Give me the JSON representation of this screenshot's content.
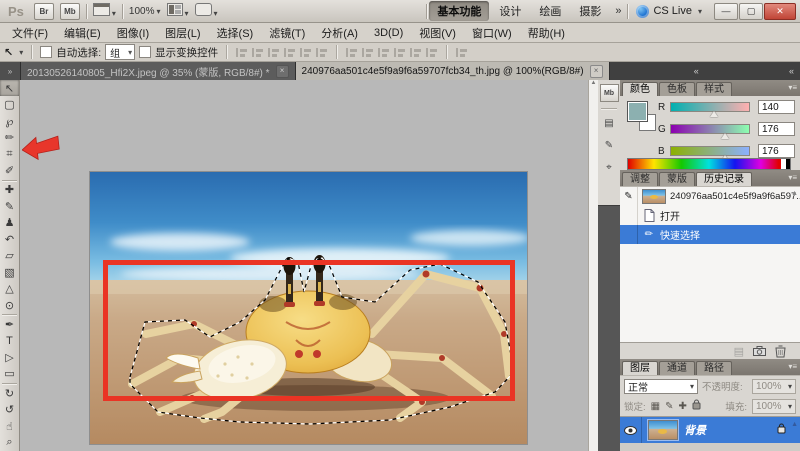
{
  "titlebar": {
    "logo": "Ps",
    "bridge_button": "Br",
    "minibridge_button": "Mb",
    "zoom_value": "100%",
    "workspaces": [
      "基本功能",
      "设计",
      "绘画",
      "摄影"
    ],
    "workspace_overflow": "»",
    "cs_live_label": "CS Live",
    "minimize_glyph": "—",
    "maximize_glyph": "▢",
    "close_glyph": "✕"
  },
  "menubar": [
    "文件(F)",
    "编辑(E)",
    "图像(I)",
    "图层(L)",
    "选择(S)",
    "滤镜(T)",
    "分析(A)",
    "3D(D)",
    "视图(V)",
    "窗口(W)",
    "帮助(H)"
  ],
  "optionsbar": {
    "auto_select_label": "自动选择:",
    "auto_select_value": "组",
    "show_transform_label": "显示变换控件"
  },
  "tabs": [
    {
      "title": "20130526140805_Hfi2X.jpeg @ 35% (蒙版, RGB/8#) *"
    },
    {
      "title": "240976aa501c4e5f9a9f6a59707fcb34_th.jpg @ 100%(RGB/8#)"
    }
  ],
  "tools": [
    {
      "name": "move",
      "glyph": "↖"
    },
    {
      "name": "rectangular-marquee",
      "glyph": "▢"
    },
    {
      "name": "lasso",
      "glyph": "℘"
    },
    {
      "name": "quick-selection",
      "glyph": "✏"
    },
    {
      "name": "crop",
      "glyph": "⌗"
    },
    {
      "name": "eyedropper",
      "glyph": "✐"
    },
    {
      "name": "spot-healing-brush",
      "glyph": "✚"
    },
    {
      "name": "brush",
      "glyph": "✎"
    },
    {
      "name": "clone-stamp",
      "glyph": "♟"
    },
    {
      "name": "history-brush",
      "glyph": "↶"
    },
    {
      "name": "eraser",
      "glyph": "▱"
    },
    {
      "name": "gradient",
      "glyph": "▧"
    },
    {
      "name": "blur",
      "glyph": "△"
    },
    {
      "name": "dodge",
      "glyph": "⊙"
    },
    {
      "name": "pen",
      "glyph": "✒"
    },
    {
      "name": "type",
      "glyph": "T"
    },
    {
      "name": "path-selection",
      "glyph": "▷"
    },
    {
      "name": "rectangle",
      "glyph": "▭"
    },
    {
      "name": "rotate-3d",
      "glyph": "↻"
    },
    {
      "name": "roll-3d",
      "glyph": "↺"
    },
    {
      "name": "hand",
      "glyph": "☝"
    },
    {
      "name": "zoom",
      "glyph": "⌕"
    }
  ],
  "color_panel": {
    "tabs": [
      "颜色",
      "色板",
      "样式"
    ],
    "r_label": "R",
    "r_value": "140",
    "g_label": "G",
    "g_value": "176",
    "b_label": "B",
    "b_value": "176",
    "foreground_hex": "#8cb0b0"
  },
  "history_panel": {
    "tabs": [
      "调整",
      "蒙版",
      "历史记录"
    ],
    "source_name": "240976aa501c4e5f9a9f6a597...",
    "states": [
      {
        "label": "打开"
      },
      {
        "label": "快速选择"
      }
    ]
  },
  "layers_panel": {
    "tabs": [
      "图层",
      "通道",
      "路径"
    ],
    "blend_mode": "正常",
    "opacity_label": "不透明度:",
    "opacity_value": "100%",
    "lock_label": "锁定:",
    "fill_label": "填充:",
    "fill_value": "100%",
    "layer_name": "背景"
  }
}
